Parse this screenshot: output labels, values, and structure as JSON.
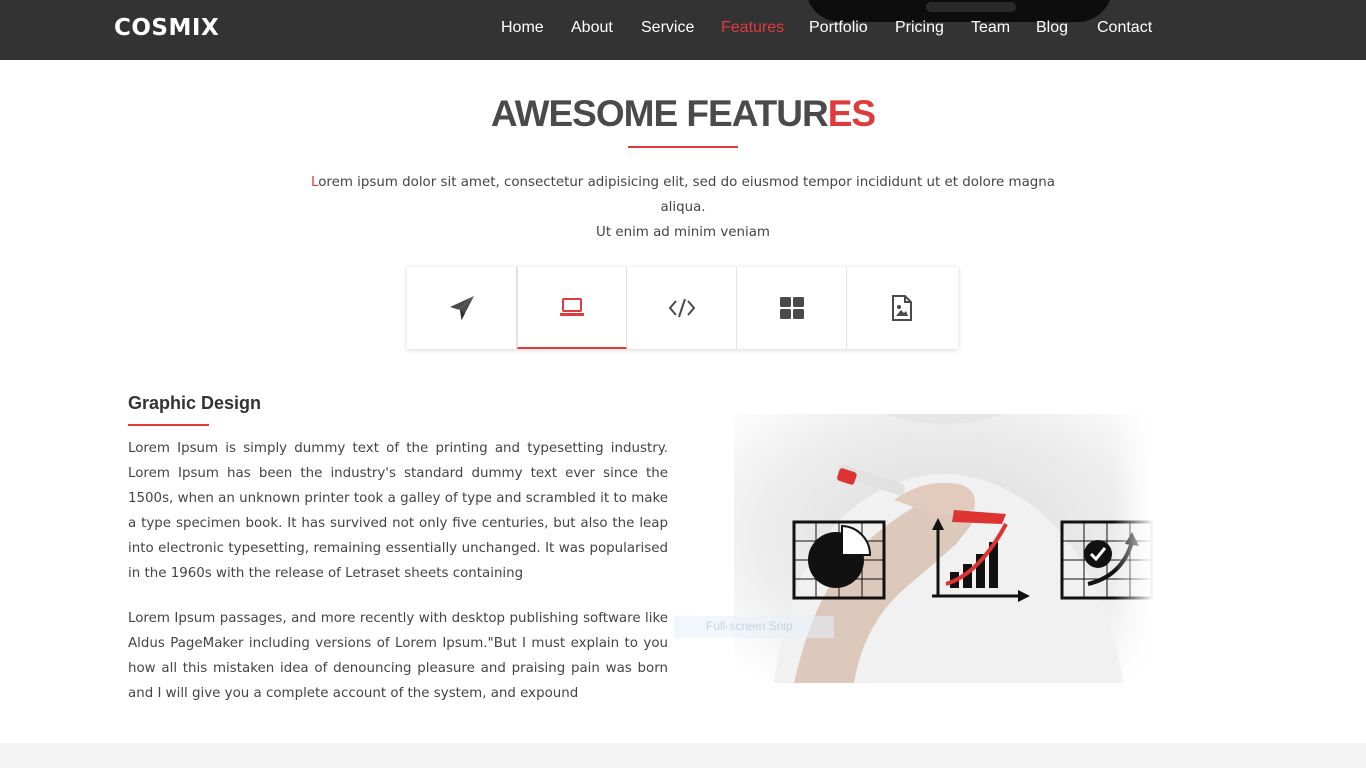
{
  "header": {
    "logo": "COSMIX",
    "nav": [
      {
        "label": "Home",
        "active": false
      },
      {
        "label": "About",
        "active": false
      },
      {
        "label": "Service",
        "active": false
      },
      {
        "label": "Features",
        "active": true
      },
      {
        "label": "Portfolio",
        "active": false
      },
      {
        "label": "Pricing",
        "active": false
      },
      {
        "label": "Team",
        "active": false
      },
      {
        "label": "Blog",
        "active": false
      },
      {
        "label": "Contact",
        "active": false
      }
    ]
  },
  "features": {
    "title_main": "AWESOME FEATUR",
    "title_accent": "ES",
    "intro_first_letter": "L",
    "intro_line1_rest": "orem ipsum dolor sit amet, consectetur adipisicing elit, sed do eiusmod tempor incididunt ut et dolore magna aliqua.",
    "intro_line2": "Ut enim ad minim veniam",
    "tabs": [
      {
        "icon": "paper-plane-icon",
        "active": false
      },
      {
        "icon": "laptop-icon",
        "active": true
      },
      {
        "icon": "code-icon",
        "active": false
      },
      {
        "icon": "grid-icon",
        "active": false
      },
      {
        "icon": "image-file-icon",
        "active": false
      }
    ],
    "active_panel": {
      "heading": "Graphic Design",
      "paragraph1": "Lorem Ipsum is simply dummy text of the printing and typesetting industry. Lorem Ipsum has been the industry's standard dummy text ever since the 1500s, when an unknown printer took a galley of type and scrambled it to make a type specimen book. It has survived not only five centuries, but also the leap into electronic typesetting, remaining essentially unchanged. It was popularised in the 1960s with the release of Letraset sheets containing",
      "paragraph2": "Lorem Ipsum passages, and more recently with desktop publishing software like Aldus PageMaker including versions of Lorem Ipsum.\"But I must explain to you how all this mistaken idea of denouncing pleasure and praising pain was born and I will give you a complete account of the system, and expound"
    }
  },
  "overlay": {
    "snip_label": "Full-screen Snip"
  },
  "colors": {
    "accent": "#e03a3c",
    "header_bg": "#333333",
    "text": "#444444",
    "icon": "#4a4a4a"
  }
}
